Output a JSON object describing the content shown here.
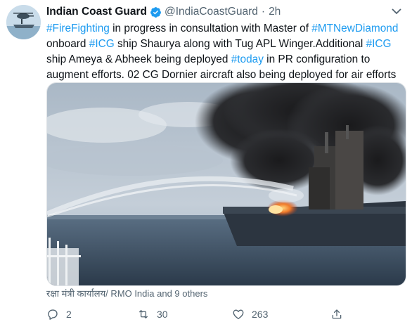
{
  "tweet": {
    "display_name": "Indian Coast Guard",
    "handle": "@IndiaCoastGuard",
    "separator": "·",
    "time": "2h",
    "lines": [
      [
        {
          "text": "#FireFighting",
          "tag": true
        },
        {
          "text": " in progress in consultation with Master of ",
          "tag": false
        },
        {
          "text": "#MTNewDiamond",
          "tag": true
        }
      ],
      [
        {
          "text": "onboard ",
          "tag": false
        },
        {
          "text": "#ICG",
          "tag": true
        },
        {
          "text": " ship Shaurya along with Tug APL Winger.Additional ",
          "tag": false
        },
        {
          "text": "#ICG",
          "tag": true
        }
      ],
      [
        {
          "text": "ship Ameya & Abheek being deployed ",
          "tag": false
        },
        {
          "text": "#today",
          "tag": true
        },
        {
          "text": " in PR configuration to",
          "tag": false
        }
      ],
      [
        {
          "text": "augment efforts. 02 CG Dornier aircraft also being deployed for air efforts",
          "tag": false
        }
      ]
    ],
    "social_context": "रक्षा मंत्री कार्यालय/ RMO India and 9 others",
    "actions": {
      "reply_count": "2",
      "retweet_count": "30",
      "like_count": "263"
    }
  },
  "colors": {
    "hashtag": "#1d9bf0",
    "verified": "#1d9bf0",
    "secondary_text": "#536471"
  },
  "icons": [
    "verified-badge-icon",
    "more-icon",
    "reply-icon",
    "retweet-icon",
    "like-icon",
    "share-icon"
  ]
}
